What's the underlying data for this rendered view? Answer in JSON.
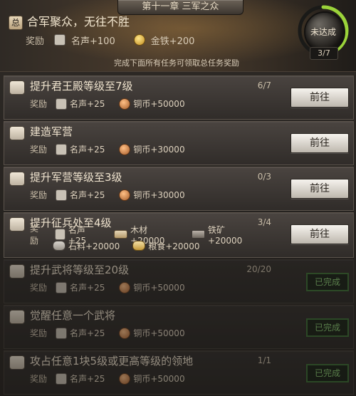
{
  "header": {
    "chapter": "第十一章 三军之众",
    "main_quest": {
      "title": "合军聚众，无往不胜",
      "reward_label": "奖励",
      "rewards": [
        {
          "icon": "fame-icon",
          "text": "名声+100"
        },
        {
          "icon": "gold-icon",
          "text": "金铁+200"
        }
      ],
      "hint": "完成下面所有任务可领取总任务奖励",
      "status": "未达成",
      "progress": "3/7",
      "progress_fraction": 0.43
    }
  },
  "quests": [
    {
      "title": "提升君王殿等级至7级",
      "progress": "6/7",
      "reward_label": "奖励",
      "rewards": [
        {
          "icon": "fame-icon",
          "text": "名声+25"
        },
        {
          "icon": "copper-icon",
          "text": "铜币+50000"
        }
      ],
      "action": "前往",
      "done": false
    },
    {
      "title": "建造军营",
      "progress": "",
      "reward_label": "奖励",
      "rewards": [
        {
          "icon": "fame-icon",
          "text": "名声+25"
        },
        {
          "icon": "copper-icon",
          "text": "铜币+30000"
        }
      ],
      "action": "前往",
      "done": false
    },
    {
      "title": "提升军营等级至3级",
      "progress": "0/3",
      "reward_label": "奖励",
      "rewards": [
        {
          "icon": "fame-icon",
          "text": "名声+25"
        },
        {
          "icon": "copper-icon",
          "text": "铜币+30000"
        }
      ],
      "action": "前往",
      "done": false
    },
    {
      "title": "提升征兵处至4级",
      "progress": "3/4",
      "reward_label": "奖励",
      "rewards_line1": [
        {
          "icon": "fame-icon",
          "text": "名声+25"
        },
        {
          "icon": "wood-icon",
          "text": "木材+20000"
        },
        {
          "icon": "iron-icon",
          "text": "铁矿+20000"
        }
      ],
      "rewards_line2": [
        {
          "icon": "stone-icon",
          "text": "石料+20000"
        },
        {
          "icon": "grain-icon",
          "text": "粮食+20000"
        }
      ],
      "action": "前往",
      "done": false
    },
    {
      "title": "提升武将等级至20级",
      "progress": "20/20",
      "reward_label": "奖励",
      "rewards": [
        {
          "icon": "fame-icon",
          "text": "名声+25"
        },
        {
          "icon": "copper-icon",
          "text": "铜币+50000"
        }
      ],
      "action": "已完成",
      "done": true
    },
    {
      "title": "觉醒任意一个武将",
      "progress": "",
      "reward_label": "奖励",
      "rewards": [
        {
          "icon": "fame-icon",
          "text": "名声+25"
        },
        {
          "icon": "copper-icon",
          "text": "铜币+50000"
        }
      ],
      "action": "已完成",
      "done": true
    },
    {
      "title": "攻占任意1块5级或更高等级的领地",
      "progress": "1/1",
      "reward_label": "奖励",
      "rewards": [
        {
          "icon": "fame-icon",
          "text": "名声+25"
        },
        {
          "icon": "copper-icon",
          "text": "铜币+50000"
        }
      ],
      "action": "已完成",
      "done": true
    }
  ],
  "colors": {
    "progress_ring": "#9bd33a",
    "done_green": "#85c96f"
  }
}
